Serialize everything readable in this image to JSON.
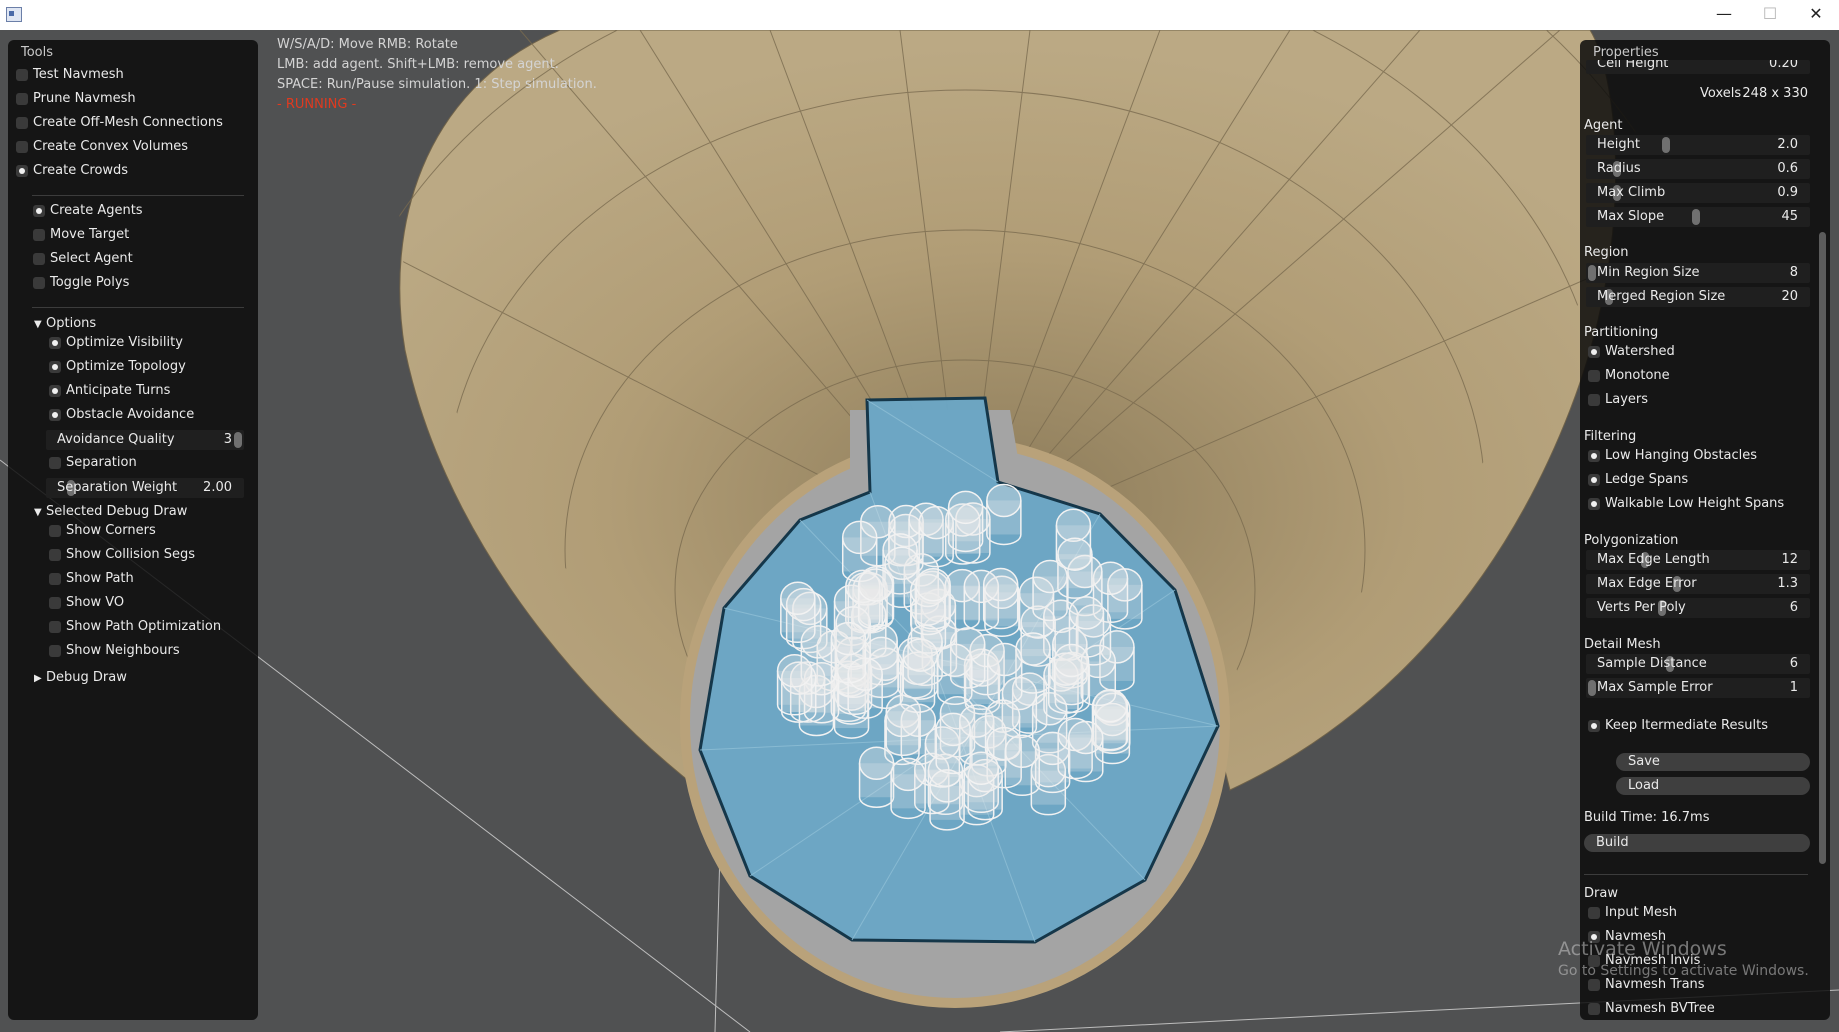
{
  "window": {
    "minimize": "—",
    "maximize": "☐",
    "close": "✕"
  },
  "hints": {
    "line1": "W/S/A/D: Move  RMB: Rotate",
    "line2": "LMB: add agent.  Shift+LMB: remove agent.",
    "line3": "SPACE: Run/Pause simulation.  1: Step simulation.",
    "status": "- RUNNING -"
  },
  "tools": {
    "title": "Tools",
    "items": [
      {
        "label": "Test Navmesh",
        "checked": false
      },
      {
        "label": "Prune Navmesh",
        "checked": false
      },
      {
        "label": "Create Off-Mesh Connections",
        "checked": false
      },
      {
        "label": "Create Convex Volumes",
        "checked": false
      },
      {
        "label": "Create Crowds",
        "checked": true
      }
    ],
    "crowd_modes": [
      {
        "label": "Create Agents",
        "checked": true
      },
      {
        "label": "Move Target",
        "checked": false
      },
      {
        "label": "Select Agent",
        "checked": false
      },
      {
        "label": "Toggle Polys",
        "checked": false
      }
    ],
    "options": {
      "header": "Options",
      "items": [
        {
          "label": "Optimize Visibility",
          "checked": true
        },
        {
          "label": "Optimize Topology",
          "checked": true
        },
        {
          "label": "Anticipate Turns",
          "checked": true
        },
        {
          "label": "Obstacle Avoidance",
          "checked": true
        }
      ],
      "avoidance_quality": {
        "label": "Avoidance Quality",
        "value": "3",
        "fraction": 1.0
      },
      "separation": {
        "label": "Separation",
        "checked": false
      },
      "separation_weight": {
        "label": "Separation Weight",
        "value": "2.00",
        "fraction": 0.1
      }
    },
    "debug": {
      "header": "Selected Debug Draw",
      "items": [
        {
          "label": "Show Corners",
          "checked": false
        },
        {
          "label": "Show Collision Segs",
          "checked": false
        },
        {
          "label": "Show Path",
          "checked": false
        },
        {
          "label": "Show VO",
          "checked": false
        },
        {
          "label": "Show Path Optimization",
          "checked": false
        },
        {
          "label": "Show Neighbours",
          "checked": false
        }
      ]
    },
    "debug_draw": "Debug Draw"
  },
  "props": {
    "title": "Properties",
    "cell_height": {
      "label": "Cell Height",
      "value": "0.20"
    },
    "voxels_label": "Voxels",
    "voxels_value": "248 x 330",
    "agent": {
      "header": "Agent",
      "sliders": [
        {
          "label": "Height",
          "value": "2.0",
          "fraction": 0.35
        },
        {
          "label": "Radius",
          "value": "0.6",
          "fraction": 0.12
        },
        {
          "label": "Max Climb",
          "value": "0.9",
          "fraction": 0.12
        },
        {
          "label": "Max Slope",
          "value": "45",
          "fraction": 0.49
        }
      ]
    },
    "region": {
      "header": "Region",
      "sliders": [
        {
          "label": "Min Region Size",
          "value": "8",
          "fraction": 0.0
        },
        {
          "label": "Merged Region Size",
          "value": "20",
          "fraction": 0.08
        }
      ]
    },
    "partitioning": {
      "header": "Partitioning",
      "items": [
        {
          "label": "Watershed",
          "checked": true
        },
        {
          "label": "Monotone",
          "checked": false
        },
        {
          "label": "Layers",
          "checked": false
        }
      ]
    },
    "filtering": {
      "header": "Filtering",
      "items": [
        {
          "label": "Low Hanging Obstacles",
          "checked": true
        },
        {
          "label": "Ledge Spans",
          "checked": true
        },
        {
          "label": "Walkable Low Height Spans",
          "checked": true
        }
      ]
    },
    "polygonization": {
      "header": "Polygonization",
      "sliders": [
        {
          "label": "Max Edge Length",
          "value": "12",
          "fraction": 0.25
        },
        {
          "label": "Max Edge Error",
          "value": "1.3",
          "fraction": 0.4
        },
        {
          "label": "Verts Per Poly",
          "value": "6",
          "fraction": 0.33
        }
      ]
    },
    "detail": {
      "header": "Detail Mesh",
      "sliders": [
        {
          "label": "Sample Distance",
          "value": "6",
          "fraction": 0.37
        },
        {
          "label": "Max Sample Error",
          "value": "1",
          "fraction": 0.0
        }
      ]
    },
    "keep_intermediate": {
      "label": "Keep Itermediate Results",
      "checked": true
    },
    "save": "Save",
    "load": "Load",
    "build_time": "Build Time: 16.7ms",
    "build": "Build",
    "draw": {
      "header": "Draw",
      "items": [
        {
          "label": "Input Mesh",
          "checked": false
        },
        {
          "label": "Navmesh",
          "checked": true
        },
        {
          "label": "Navmesh Invis",
          "checked": false
        },
        {
          "label": "Navmesh Trans",
          "checked": false
        },
        {
          "label": "Navmesh BVTree",
          "checked": false
        }
      ]
    }
  },
  "watermark": {
    "line1": "Activate Windows",
    "line2": "Go to Settings to activate Windows."
  },
  "colors": {
    "floor": "#505152",
    "wall": "#b19d76",
    "navmesh": "#6aa6c6",
    "navmesh_edge": "#15374a",
    "agent": "#f2f2f2",
    "running": "#e03a1f"
  }
}
